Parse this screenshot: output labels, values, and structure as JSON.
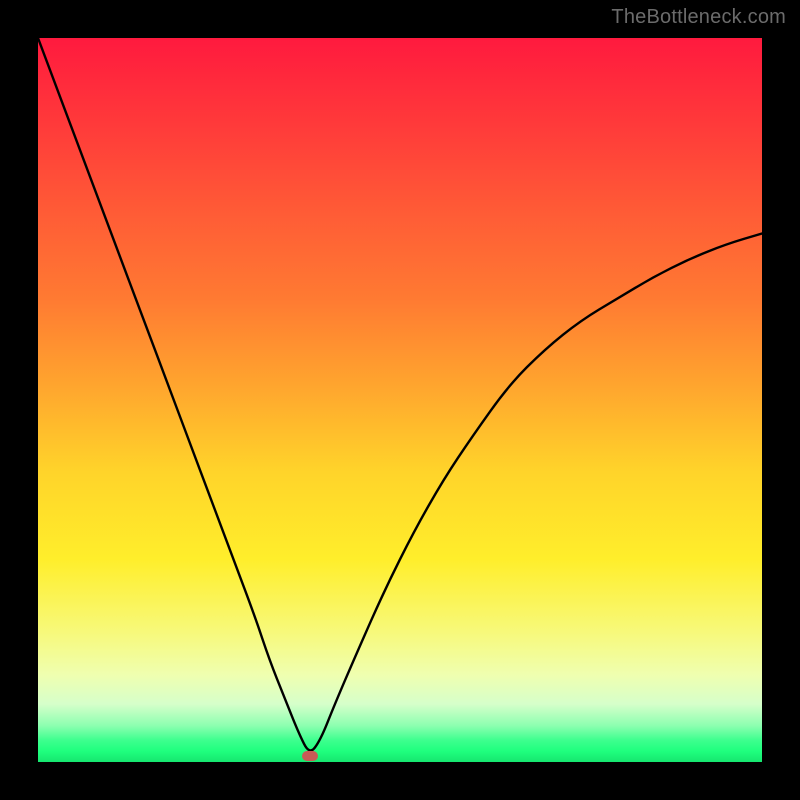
{
  "watermark": "TheBottleneck.com",
  "colors": {
    "frame": "#000000",
    "curve": "#000000",
    "marker": "#c75b56"
  },
  "chart_data": {
    "type": "line",
    "title": "",
    "xlabel": "",
    "ylabel": "",
    "xlim": [
      0,
      100
    ],
    "ylim": [
      0,
      100
    ],
    "grid": false,
    "legend": false,
    "series": [
      {
        "name": "bottleneck-curve",
        "x": [
          0,
          3,
          6,
          9,
          12,
          15,
          18,
          21,
          24,
          27,
          30,
          32,
          34,
          36,
          37.5,
          39,
          41,
          44,
          48,
          52,
          56,
          60,
          65,
          70,
          75,
          80,
          85,
          90,
          95,
          100
        ],
        "y": [
          100,
          92,
          84,
          76,
          68,
          60,
          52,
          44,
          36,
          28,
          20,
          14,
          9,
          4,
          1,
          3,
          8,
          15,
          24,
          32,
          39,
          45,
          52,
          57,
          61,
          64,
          67,
          69.5,
          71.5,
          73
        ]
      }
    ],
    "optimum_marker": {
      "x": 37.5,
      "y": 0.8
    },
    "gradient_stops": [
      {
        "pct": 0,
        "color": "#ff1a3e"
      },
      {
        "pct": 24,
        "color": "#ff5b36"
      },
      {
        "pct": 48,
        "color": "#ffa52e"
      },
      {
        "pct": 72,
        "color": "#ffee2b"
      },
      {
        "pct": 92,
        "color": "#d6ffca"
      },
      {
        "pct": 100,
        "color": "#16e66f"
      }
    ]
  }
}
